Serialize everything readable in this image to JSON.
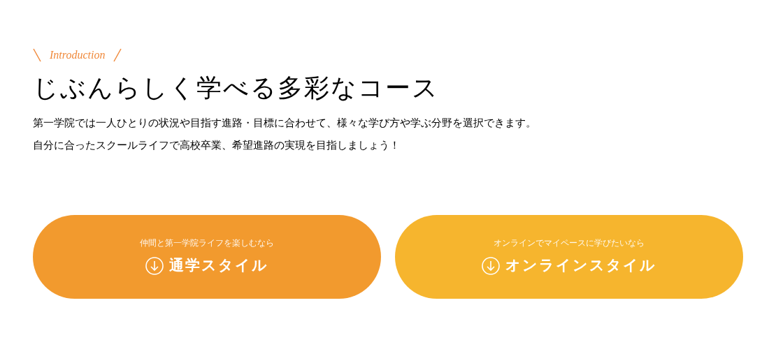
{
  "eyebrow": "Introduction",
  "heading": "じぶんらしく学べる多彩なコース",
  "lead": [
    "第一学院では一人ひとりの状況や目指す進路・目標に合わせて、様々な学び方や学ぶ分野を選択できます。",
    "自分に合ったスクールライフで高校卒業、希望進路の実現を目指しましょう！"
  ],
  "courses": [
    {
      "caption": "仲間と第一学院ライフを楽しむなら",
      "label": "通学スタイル",
      "color": "#f29a2e"
    },
    {
      "caption": "オンラインでマイペースに学びたいなら",
      "label": "オンラインスタイル",
      "color": "#f6b52e"
    }
  ]
}
